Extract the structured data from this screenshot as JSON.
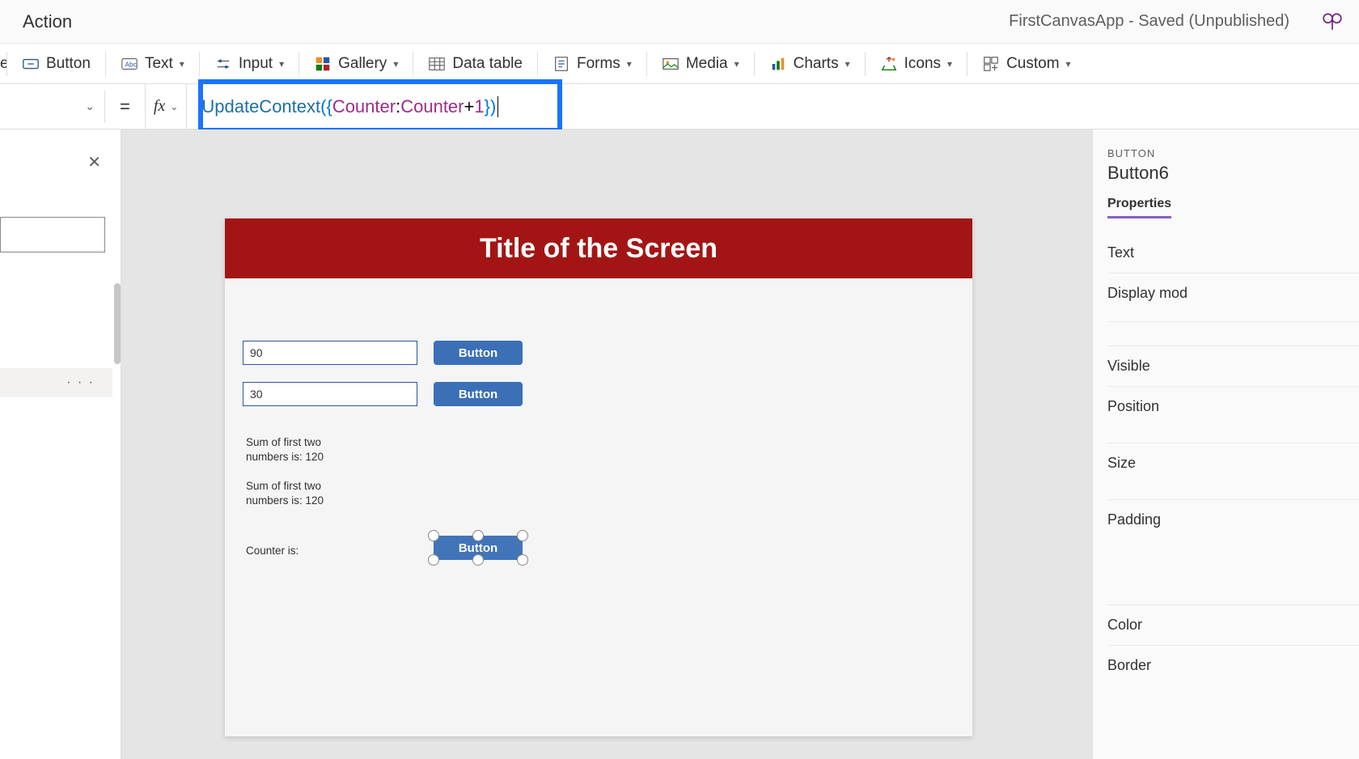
{
  "header": {
    "menu_action": "Action",
    "app_status": "FirstCanvasApp - Saved (Unpublished)"
  },
  "ribbon": {
    "label_cut": "el",
    "button": "Button",
    "text": "Text",
    "input": "Input",
    "gallery": "Gallery",
    "datatable": "Data table",
    "forms": "Forms",
    "media": "Media",
    "charts": "Charts",
    "icons": "Icons",
    "custom": "Custom"
  },
  "formula": {
    "eq": "=",
    "fx": "fx",
    "fn": "UpdateContext",
    "open": "({",
    "key": "Counter",
    "colon": ": ",
    "ref": "Counter",
    "op": " + ",
    "num": "1",
    "close": "})"
  },
  "left": {
    "tree_more": "· · ·"
  },
  "canvas": {
    "title": "Title of the Screen",
    "input1": "90",
    "input2": "30",
    "btn1": "Button",
    "btn2": "Button",
    "sum1": "Sum of first two numbers is: 120",
    "sum2": "Sum of first two numbers is: 120",
    "counter_label": "Counter is:",
    "sel_btn": "Button"
  },
  "right": {
    "category": "BUTTON",
    "name": "Button6",
    "tab_properties": "Properties",
    "rows": {
      "text": "Text",
      "display_mode": "Display mod",
      "visible": "Visible",
      "position": "Position",
      "size": "Size",
      "padding": "Padding",
      "color": "Color",
      "border": "Border"
    }
  }
}
